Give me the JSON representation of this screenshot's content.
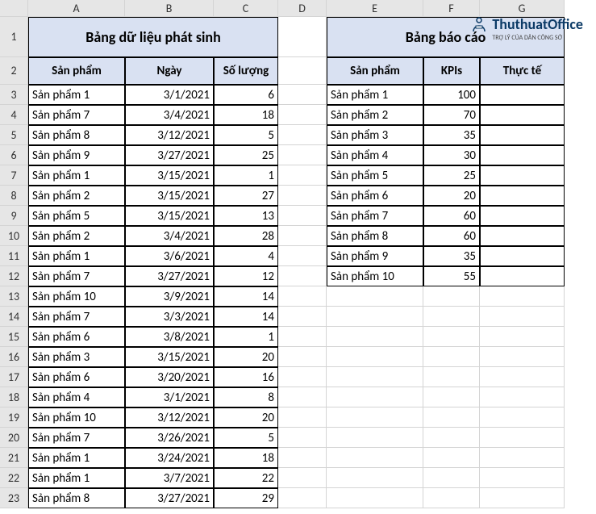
{
  "colHeaders": [
    "A",
    "B",
    "C",
    "D",
    "E",
    "F",
    "G"
  ],
  "titleLeft": "Bảng dữ liệu phát sinh",
  "titleRight": "Bảng báo cáo",
  "leftHeaders": {
    "a": "Sản phẩm",
    "b": "Ngày",
    "c": "Số lượng"
  },
  "rightHeaders": {
    "e": "Sản phẩm",
    "f": "KPIs",
    "g": "Thực tế"
  },
  "leftRows": [
    {
      "a": "Sản phẩm 1",
      "b": "3/1/2021",
      "c": 6
    },
    {
      "a": "Sản phẩm 7",
      "b": "3/4/2021",
      "c": 18
    },
    {
      "a": "Sản phẩm 8",
      "b": "3/12/2021",
      "c": 5
    },
    {
      "a": "Sản phẩm 9",
      "b": "3/27/2021",
      "c": 25
    },
    {
      "a": "Sản phẩm 1",
      "b": "3/15/2021",
      "c": 1
    },
    {
      "a": "Sản phẩm 2",
      "b": "3/15/2021",
      "c": 27
    },
    {
      "a": "Sản phẩm 5",
      "b": "3/15/2021",
      "c": 13
    },
    {
      "a": "Sản phẩm 2",
      "b": "3/4/2021",
      "c": 28
    },
    {
      "a": "Sản phẩm 1",
      "b": "3/6/2021",
      "c": 4
    },
    {
      "a": "Sản phẩm 7",
      "b": "3/27/2021",
      "c": 12
    },
    {
      "a": "Sản phẩm 10",
      "b": "3/9/2021",
      "c": 14
    },
    {
      "a": "Sản phẩm 7",
      "b": "3/3/2021",
      "c": 14
    },
    {
      "a": "Sản phẩm 6",
      "b": "3/8/2021",
      "c": 1
    },
    {
      "a": "Sản phẩm 3",
      "b": "3/15/2021",
      "c": 20
    },
    {
      "a": "Sản phẩm 6",
      "b": "3/20/2021",
      "c": 16
    },
    {
      "a": "Sản phẩm 4",
      "b": "3/1/2021",
      "c": 8
    },
    {
      "a": "Sản phẩm 10",
      "b": "3/12/2021",
      "c": 20
    },
    {
      "a": "Sản phẩm 7",
      "b": "3/26/2021",
      "c": 5
    },
    {
      "a": "Sản phẩm 1",
      "b": "3/24/2021",
      "c": 18
    },
    {
      "a": "Sản phẩm 1",
      "b": "3/7/2021",
      "c": 22
    },
    {
      "a": "Sản phẩm 8",
      "b": "3/27/2021",
      "c": 29
    }
  ],
  "rightRows": [
    {
      "e": "Sản phẩm 1",
      "f": 100
    },
    {
      "e": "Sản phẩm 2",
      "f": 70
    },
    {
      "e": "Sản phẩm 3",
      "f": 35
    },
    {
      "e": "Sản phẩm 4",
      "f": 30
    },
    {
      "e": "Sản phẩm 5",
      "f": 25
    },
    {
      "e": "Sản phẩm 6",
      "f": 20
    },
    {
      "e": "Sản phẩm 7",
      "f": 60
    },
    {
      "e": "Sản phẩm 8",
      "f": 60
    },
    {
      "e": "Sản phẩm 9",
      "f": 35
    },
    {
      "e": "Sản phẩm 10",
      "f": 55
    }
  ],
  "watermark": {
    "brand": "ThuthuatOffice",
    "tagline": "TRỢ LÝ CỦA DÂN CÔNG SỞ"
  }
}
